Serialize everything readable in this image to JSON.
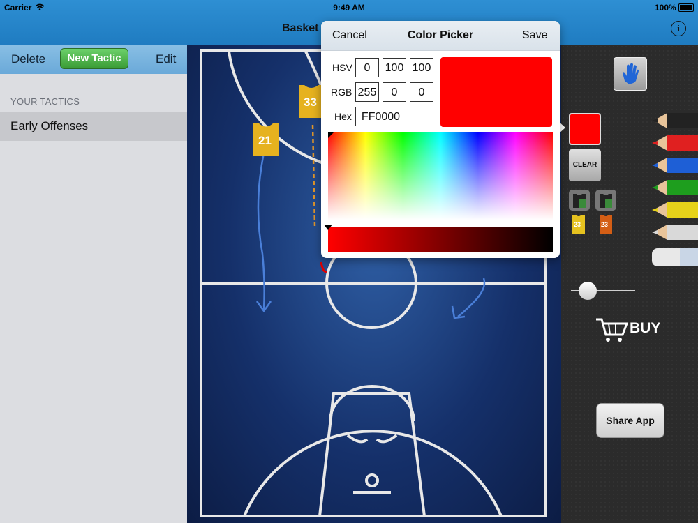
{
  "status": {
    "carrier": "Carrier",
    "time": "9:49 AM",
    "battery": "100%"
  },
  "nav": {
    "title": "Basket"
  },
  "left": {
    "delete_label": "Delete",
    "new_label": "New Tactic",
    "edit_label": "Edit",
    "section_label": "YOUR TACTICS",
    "tactics": [
      "Early Offenses"
    ]
  },
  "court": {
    "players": [
      {
        "number": "33"
      },
      {
        "number": "21"
      }
    ]
  },
  "color_picker": {
    "cancel_label": "Cancel",
    "title": "Color Picker",
    "save_label": "Save",
    "hsv_label": "HSV",
    "hsv": [
      "0",
      "100",
      "100"
    ],
    "rgb_label": "RGB",
    "rgb": [
      "255",
      "0",
      "0"
    ],
    "hex_label": "Hex",
    "hex": "FF0000",
    "selected_color": "#ff0000"
  },
  "tools": {
    "clear_label": "CLEAR",
    "jerseys": [
      "23",
      "23"
    ],
    "pencil_colors": [
      "#222222",
      "#e02020",
      "#1e5fd6",
      "#1e9e1e",
      "#e6d21a",
      "#d9d9d9"
    ],
    "buy_label": "BUY",
    "share_label": "Share App"
  }
}
